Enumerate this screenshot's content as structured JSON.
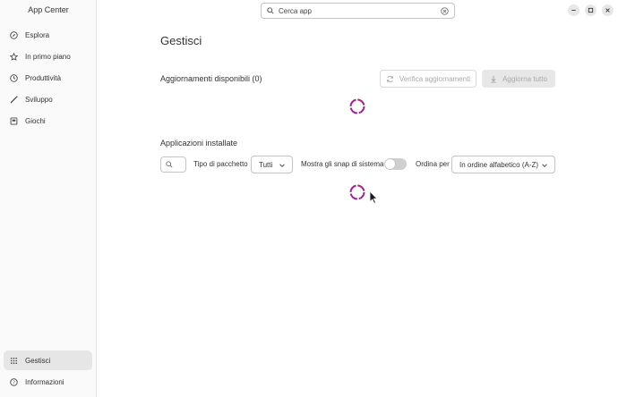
{
  "app": {
    "title": "App Center"
  },
  "search": {
    "placeholder": "Cerca app"
  },
  "sidebar": {
    "items": [
      {
        "label": "Esplora",
        "icon": "compass-icon"
      },
      {
        "label": "In primo piano",
        "icon": "star-icon"
      },
      {
        "label": "Produttività",
        "icon": "clock-icon"
      },
      {
        "label": "Sviluppo",
        "icon": "wrench-icon"
      },
      {
        "label": "Giochi",
        "icon": "gamepad-icon"
      }
    ],
    "bottom": [
      {
        "label": "Gestisci",
        "icon": "grid-icon",
        "active": true
      },
      {
        "label": "Informazioni",
        "icon": "help-icon"
      }
    ]
  },
  "main": {
    "title": "Gestisci",
    "updates": {
      "title": "Aggiornamenti disponibili (0)",
      "check_label": "Verifica aggiornamenti",
      "update_all_label": "Aggiorna tutto"
    },
    "installed": {
      "title": "Applicazioni installate",
      "package_type_label": "Tipo di pacchetto",
      "package_type_value": "Tutti",
      "show_system_snaps_label": "Mostra gli snap di sistema",
      "show_system_snaps": false,
      "sort_label": "Ordina per",
      "sort_value": "In ordine alfabetico (A-Z)"
    }
  },
  "colors": {
    "spinner": "#a3238f",
    "sidebar_bg": "#fafafa",
    "active_bg": "#e6e6e6"
  }
}
